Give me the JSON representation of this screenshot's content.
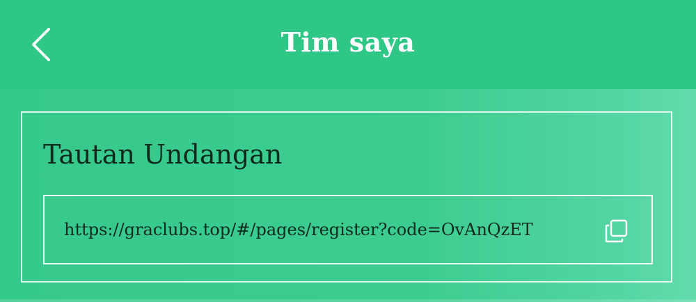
{
  "header": {
    "title": "Tim saya",
    "back_icon": "chevron-left-icon"
  },
  "invite": {
    "section_title": "Tautan Undangan",
    "link": "https://graclubs.top/#/pages/register?code=OvAnQzET",
    "copy_icon": "copy-icon"
  },
  "colors": {
    "primary": "#2fc785",
    "text_dark": "#102a1e",
    "border": "#ffffff"
  }
}
